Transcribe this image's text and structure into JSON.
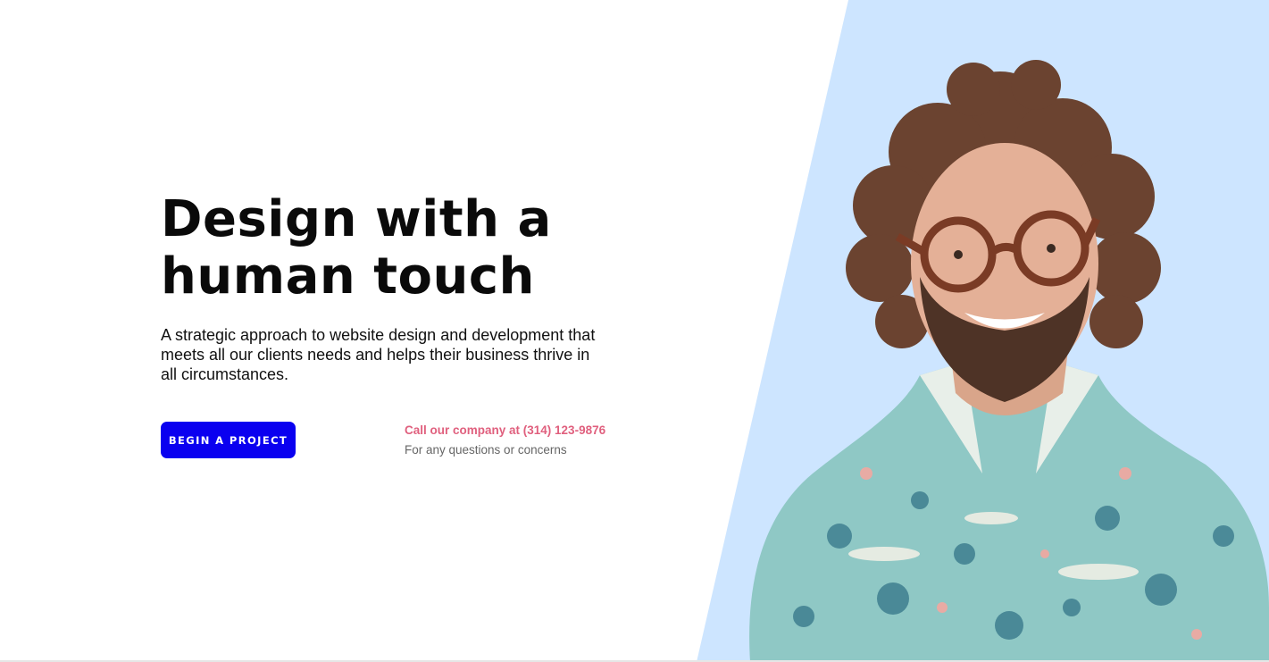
{
  "hero": {
    "headline_line1": "Design with a",
    "headline_line2": "human touch",
    "subtitle": "A strategic approach to website design and development that meets all our clients needs and helps their business thrive in all circumstances.",
    "cta_label": "BEGIN A PROJECT",
    "contact_phone": "Call our company at (314) 123-9876",
    "contact_note": "For any questions or concerns"
  },
  "colors": {
    "accent_blue": "#0a00f0",
    "phone_pink": "#e0607e",
    "panel_light_blue": "#cde5ff"
  },
  "image": {
    "subject": "smiling man with curly hair, glasses and beard wearing a floral shirt"
  }
}
